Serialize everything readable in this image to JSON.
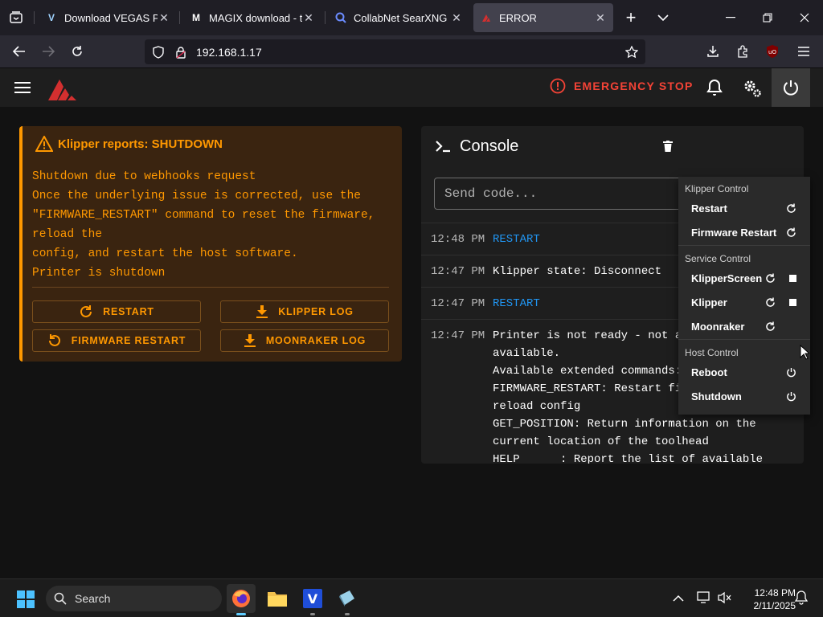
{
  "browser": {
    "tabs": [
      {
        "title": "Download VEGAS Pro T",
        "favicon": "V"
      },
      {
        "title": "MAGIX download - tha",
        "favicon": "M"
      },
      {
        "title": "CollabNet SearXNG",
        "favicon": "search-icon"
      },
      {
        "title": "ERROR",
        "favicon": "mainsail-logo"
      }
    ],
    "url": "192.168.1.17"
  },
  "app": {
    "emergency_stop": "EMERGENCY STOP",
    "warning": {
      "title": "Klipper reports: SHUTDOWN",
      "lines": [
        "Shutdown due to webhooks request",
        "Once the underlying issue is corrected, use the",
        "\"FIRMWARE_RESTART\" command to reset the firmware,",
        "reload the",
        "config, and restart the host software.",
        "Printer is shutdown"
      ],
      "buttons": {
        "restart": "RESTART",
        "klipper_log": "KLIPPER LOG",
        "firmware_restart": "FIRMWARE RESTART",
        "moonraker_log": "MOONRAKER LOG"
      }
    },
    "console": {
      "title": "Console",
      "placeholder": "Send code...",
      "entries": [
        {
          "time": "12:48 PM",
          "message": "RESTART",
          "type": "command"
        },
        {
          "time": "12:47 PM",
          "message": "Klipper state: Disconnect",
          "type": "response"
        },
        {
          "time": "12:47 PM",
          "message": "RESTART",
          "type": "command"
        },
        {
          "time": "12:47 PM",
          "message": "Printer is not ready - not al\navailable.\nAvailable extended commands:\nFIRMWARE_RESTART: Restart firmware, host, and\nreload config\nGET_POSITION: Return information on the\ncurrent location of the toolhead\nHELP      : Report the list of available",
          "type": "response"
        }
      ]
    },
    "power_menu": {
      "klipper_control": "Klipper Control",
      "restart": "Restart",
      "firmware_restart": "Firmware Restart",
      "service_control": "Service Control",
      "klipperscreen": "KlipperScreen",
      "klipper": "Klipper",
      "moonraker": "Moonraker",
      "host_control": "Host Control",
      "reboot": "Reboot",
      "shutdown": "Shutdown"
    }
  },
  "taskbar": {
    "search": "Search",
    "time": "12:48 PM",
    "date": "2/11/2025"
  },
  "colors": {
    "accent_warning": "#ff9800",
    "emergency": "#f44336",
    "command": "#2196f3",
    "warning_bg": "#3a2410"
  }
}
